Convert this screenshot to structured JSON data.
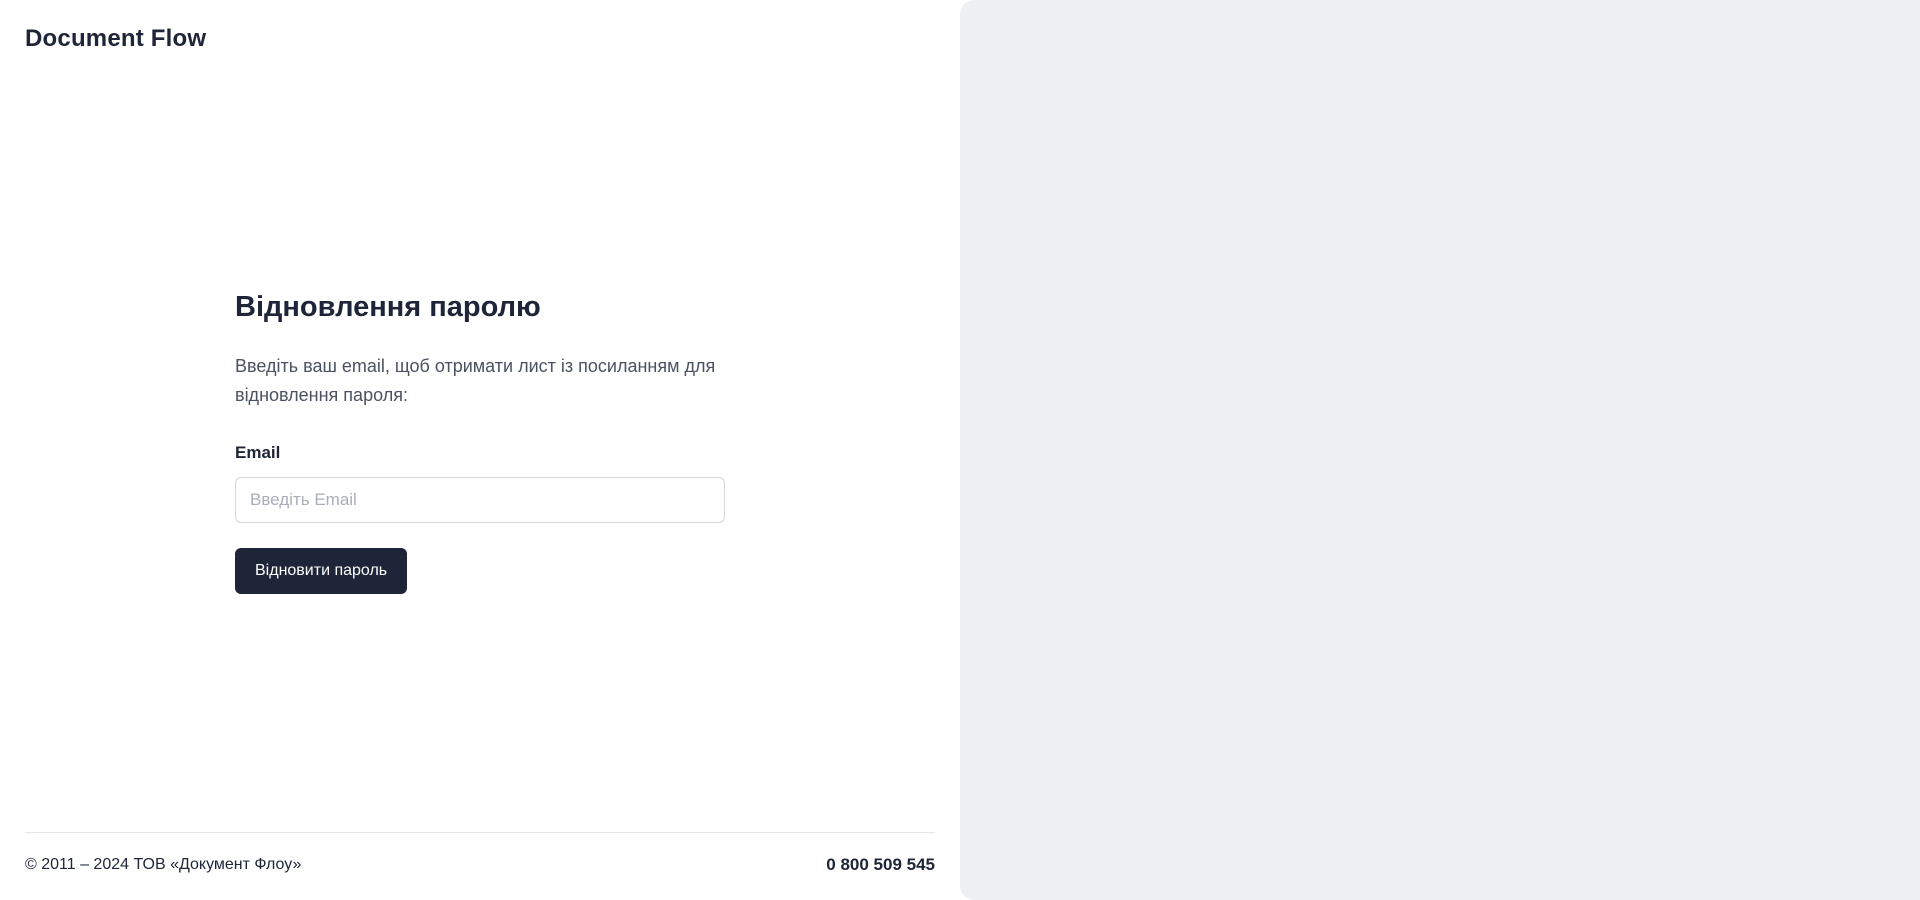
{
  "header": {
    "logo": "Document Flow"
  },
  "form": {
    "title": "Відновлення паролю",
    "description": "Введіть ваш email, щоб отримати лист із посиланням для відновлення пароля:",
    "email_label": "Email",
    "email_placeholder": "Введіть Email",
    "submit_label": "Відновити пароль"
  },
  "footer": {
    "copyright": "© 2011 – 2024 ТОВ «Документ Флоу»",
    "phone": "0 800 509 545"
  }
}
